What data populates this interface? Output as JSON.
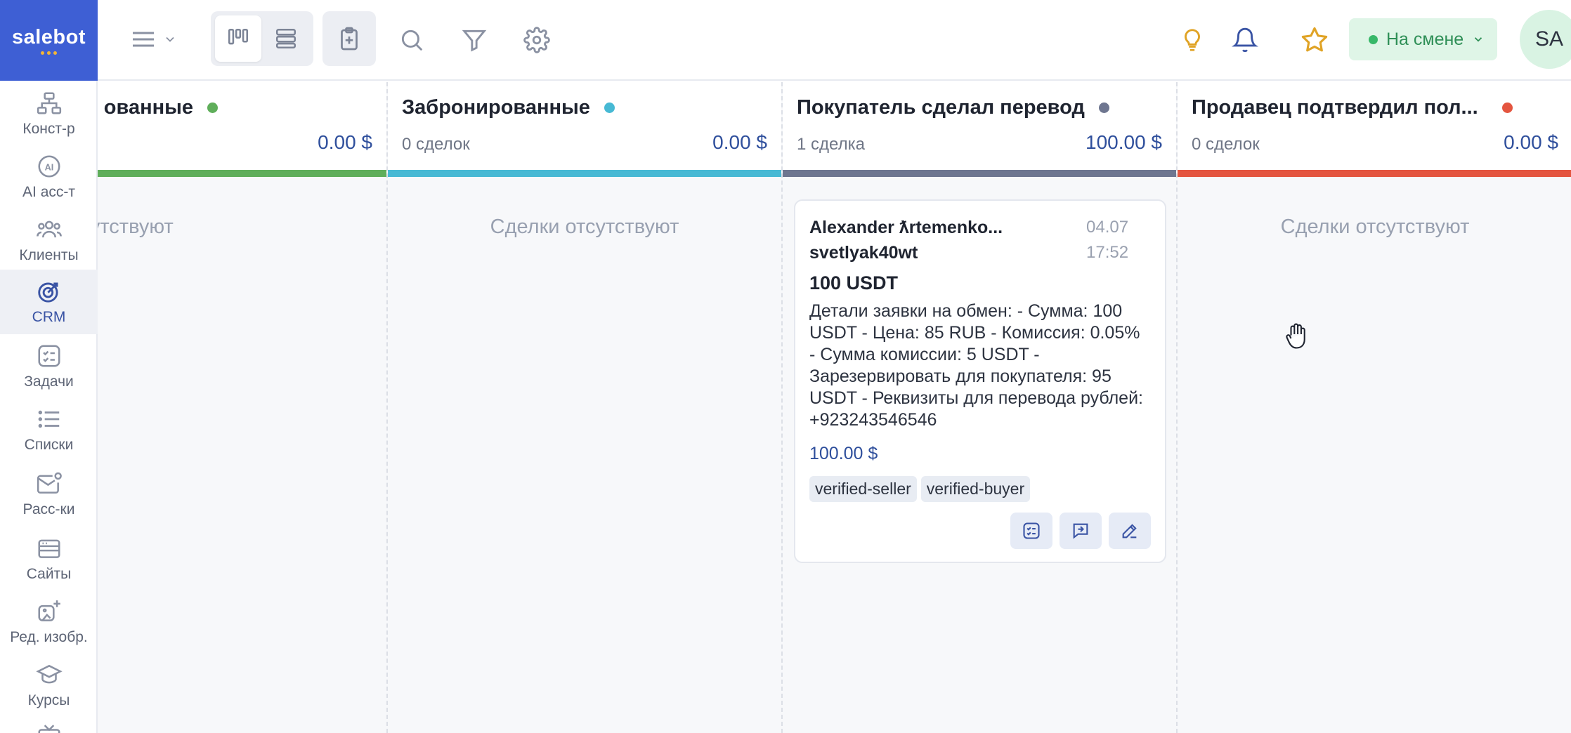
{
  "app": {
    "logo_text": "salebot",
    "brand_color": "#3e5fd4"
  },
  "sidebar": {
    "items": [
      {
        "label": "Конст-р",
        "icon": "sitemap-icon"
      },
      {
        "label": "AI асс-т",
        "icon": "ai-icon"
      },
      {
        "label": "Клиенты",
        "icon": "users-icon"
      },
      {
        "label": "CRM",
        "icon": "target-icon",
        "active": true
      },
      {
        "label": "Задачи",
        "icon": "checklist-icon"
      },
      {
        "label": "Списки",
        "icon": "list-icon"
      },
      {
        "label": "Расс-ки",
        "icon": "mail-icon"
      },
      {
        "label": "Сайты",
        "icon": "website-icon"
      },
      {
        "label": "Ред. изобр.",
        "icon": "image-edit-icon"
      },
      {
        "label": "Курсы",
        "icon": "graduation-cap-icon"
      }
    ]
  },
  "topbar": {
    "shift_label": "На смене",
    "avatar_initials": "SA"
  },
  "columns": [
    {
      "title": "ованные",
      "count": "",
      "sum": "0.00 $",
      "color": "#5fae5a",
      "empty_text": "Сделки отсутствуют"
    },
    {
      "title": "Забронированные",
      "count": "0 сделок",
      "sum": "0.00 $",
      "color": "#47b9d4",
      "empty_text": "Сделки отсутствуют"
    },
    {
      "title": "Покупатель сделал перевод",
      "count": "1 сделка",
      "sum": "100.00 $",
      "color": "#6e7690",
      "empty_text": ""
    },
    {
      "title": "Продавец подтвердил пол...",
      "count": "0 сделок",
      "sum": "0.00 $",
      "color": "#e4553f",
      "empty_text": "Сделки отсутствуют"
    }
  ],
  "deal_card": {
    "name_line1": "Alexander ƛrtemenko...",
    "name_line2": "svetlyak40wt",
    "date": "04.07",
    "time": "17:52",
    "amount": "100 USDT",
    "description": "Детали заявки на обмен: - Сумма: 100 USDT - Цена: 85 RUB - Комиссия: 0.05% - Сумма комиссии: 5 USDT - Зарезервировать для покупателя: 95 USDT - Реквизиты для перевода рублей: +923243546546",
    "sum": "100.00 $",
    "tags": [
      "verified-seller",
      "verified-buyer"
    ]
  }
}
